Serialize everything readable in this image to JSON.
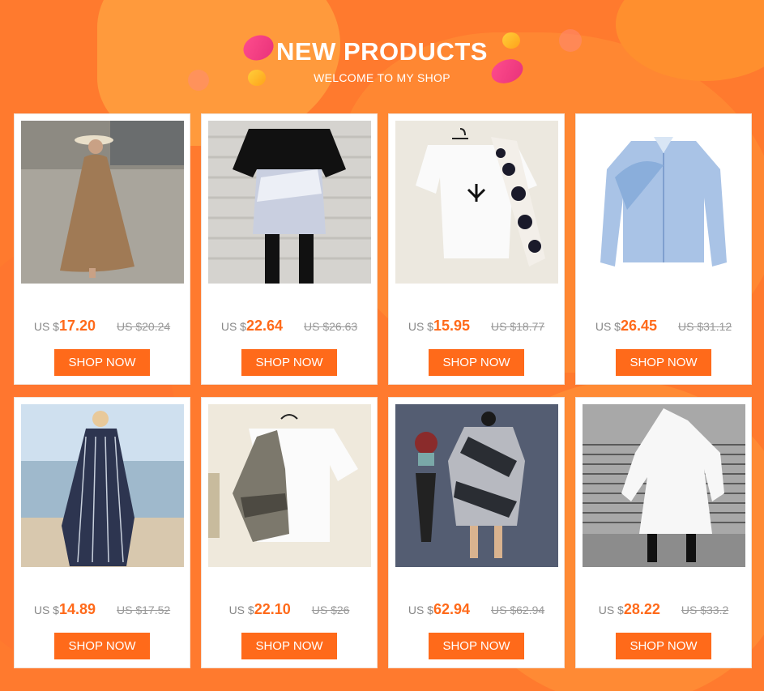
{
  "header": {
    "title": "NEW PRODUCTS",
    "subtitle": "WELCOME TO MY SHOP"
  },
  "colors": {
    "accent": "#ff6a1a",
    "background": "#ff7a2e"
  },
  "products": [
    {
      "prefix": "US $",
      "price": "17.20",
      "old_price": "US $20.24",
      "button": "SHOP NOW"
    },
    {
      "prefix": "US $",
      "price": "22.64",
      "old_price": "US $26.63",
      "button": "SHOP NOW"
    },
    {
      "prefix": "US $",
      "price": "15.95",
      "old_price": "US $18.77",
      "button": "SHOP NOW"
    },
    {
      "prefix": "US $",
      "price": "26.45",
      "old_price": "US $31.12",
      "button": "SHOP NOW"
    },
    {
      "prefix": "US $",
      "price": "14.89",
      "old_price": "US $17.52",
      "button": "SHOP NOW"
    },
    {
      "prefix": "US $",
      "price": "22.10",
      "old_price": "US $26",
      "button": "SHOP NOW"
    },
    {
      "prefix": "US $",
      "price": "62.94",
      "old_price": "US $62.94",
      "button": "SHOP NOW"
    },
    {
      "prefix": "US $",
      "price": "28.22",
      "old_price": "US $33.2",
      "button": "SHOP NOW"
    }
  ]
}
